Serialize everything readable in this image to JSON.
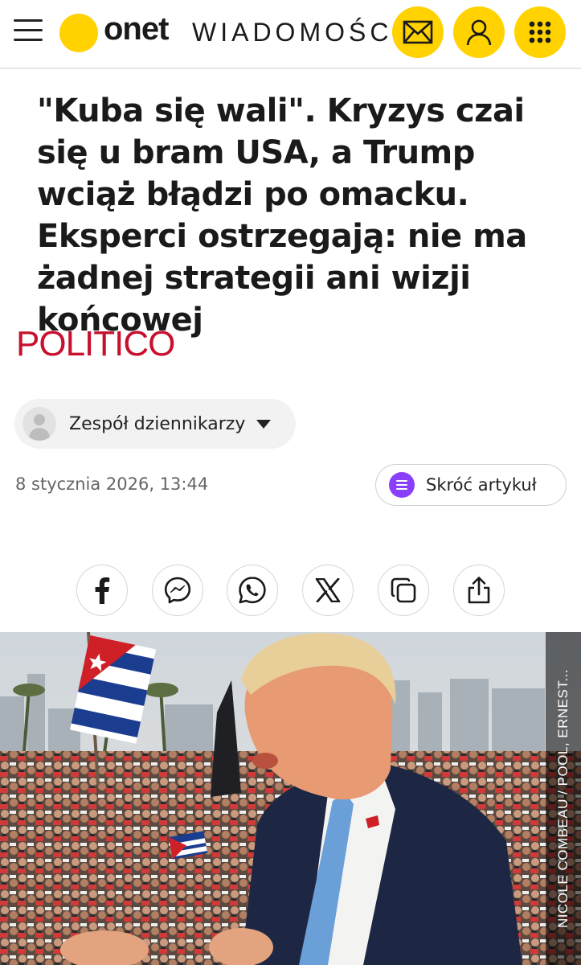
{
  "header": {
    "brand": "onet",
    "section": "WIADOMOŚCI",
    "icons": [
      "menu-icon",
      "mail-icon",
      "user-icon",
      "apps-grid-icon"
    ]
  },
  "article": {
    "headline": "\"Kuba się wali\". Kryzys czai się u bram USA, a Trump wciąż błądzi po omacku. Eksperci ostrzegają: nie ma żadnej strategii ani wizji końcowej",
    "source": "POLITICO",
    "author": "Zespół dziennikarzy",
    "date": "8 stycznia 2026, 13:44",
    "summarize_label": "Skróć artykuł"
  },
  "share": {
    "icons": [
      "facebook-icon",
      "messenger-icon",
      "whatsapp-icon",
      "x-icon",
      "copy-link-icon",
      "share-icon"
    ]
  },
  "photo": {
    "credit": "NICOLE COMBEAU / POOL, ERNEST..."
  },
  "colors": {
    "brand_yellow": "#ffd200",
    "politico_red": "#c8102e",
    "summarize_purple": "#8a3ffc"
  }
}
